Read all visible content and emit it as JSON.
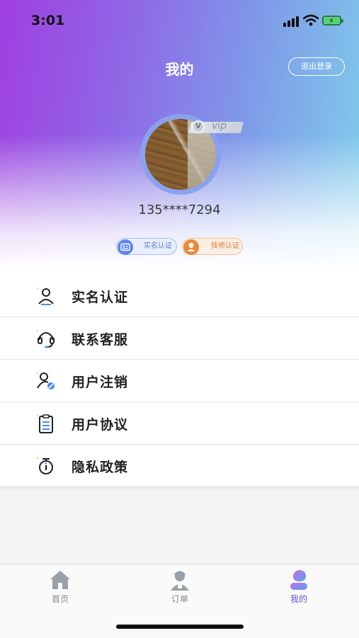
{
  "status_bar": {
    "time": "3:01"
  },
  "header": {
    "title": "我的",
    "logout_label": "退出登录"
  },
  "profile": {
    "vip_badge_letter": "V",
    "vip_label": "vip",
    "phone": "135****7294",
    "chips": [
      {
        "label": "实名认证",
        "icon": "id-card-icon",
        "color": "#5a86e8"
      },
      {
        "label": "技师认证",
        "icon": "technician-icon",
        "color": "#e98a3a"
      }
    ]
  },
  "menu": {
    "items": [
      {
        "label": "实名认证",
        "icon": "user-icon"
      },
      {
        "label": "联系客服",
        "icon": "headset-icon"
      },
      {
        "label": "用户注销",
        "icon": "user-cancel-icon"
      },
      {
        "label": "用户协议",
        "icon": "clipboard-icon"
      },
      {
        "label": "隐私政策",
        "icon": "privacy-icon"
      }
    ]
  },
  "tabbar": {
    "tabs": [
      {
        "label": "首页",
        "icon": "home-icon",
        "active": false
      },
      {
        "label": "订单",
        "icon": "orders-icon",
        "active": false
      },
      {
        "label": "我的",
        "icon": "mine-icon",
        "active": true
      }
    ]
  },
  "colors": {
    "accent": "#6a4fd6",
    "gradient_left": "#a03ee0",
    "gradient_right": "#7fd0ea"
  }
}
